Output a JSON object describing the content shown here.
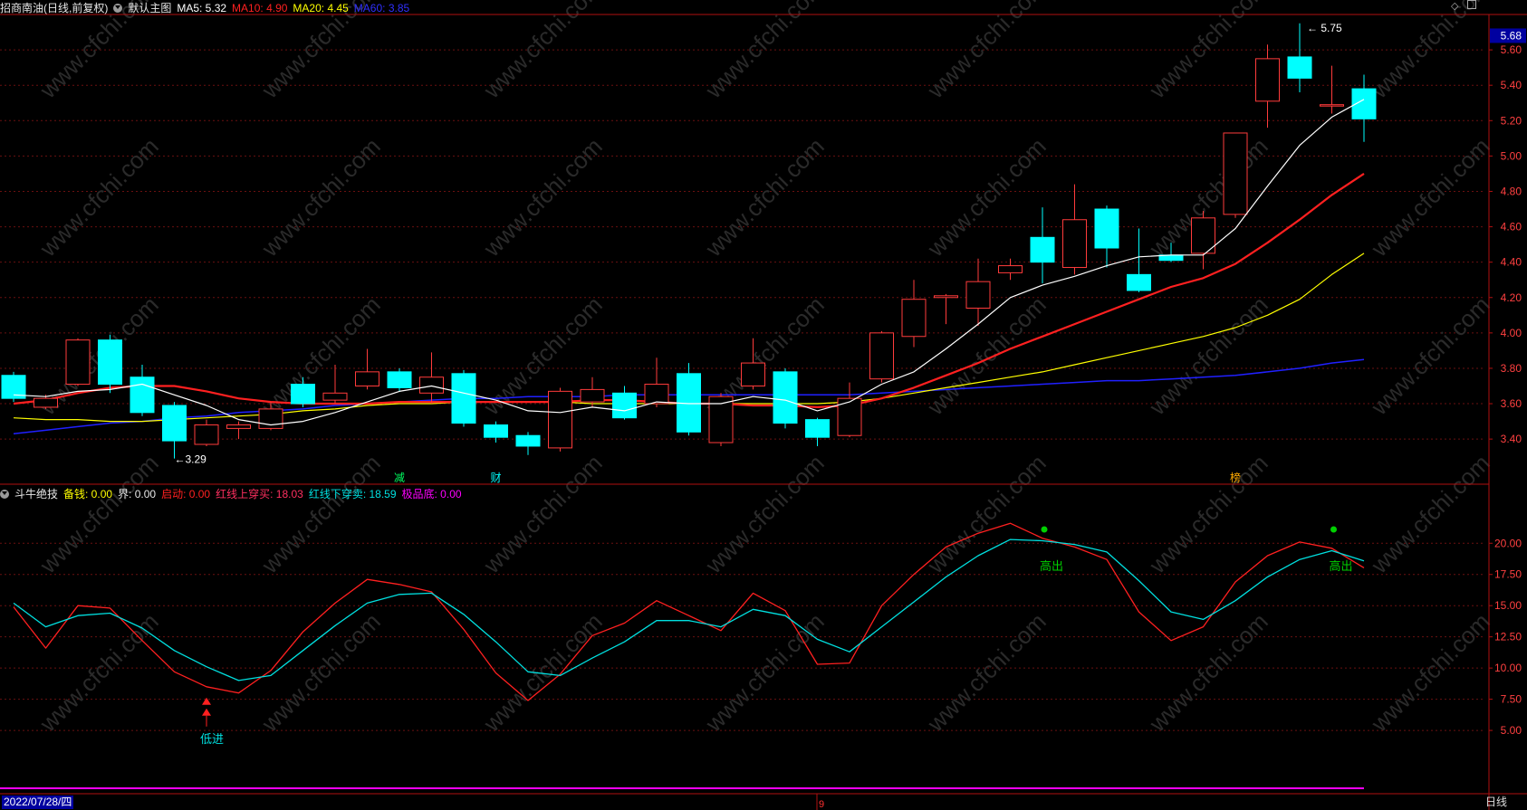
{
  "header": {
    "stock_title": "招商南油(日线,前复权)",
    "chart_name": "默认主图",
    "ma5_label": "MA5: 5.32",
    "ma10_label": "MA10: 4.90",
    "ma20_label": "MA20: 4.45",
    "ma60_label": "MA60: 3.85"
  },
  "indicator_header": {
    "name": "斗牛绝技",
    "beixian": "备钱: 0.00",
    "jie": "界: 0.00",
    "qidong": "启动: 0.00",
    "up_cross": "红线上穿买: 18.03",
    "down_cross": "红线下穿卖: 18.59",
    "bottom": "极品底: 0.00"
  },
  "footer": {
    "date": "2022/07/28/四",
    "period": "日线",
    "mid_marker": "9"
  },
  "colors": {
    "up": "#ff3b3b",
    "down": "#00ffff",
    "ma5": "#ffffff",
    "ma10": "#ff2020",
    "ma20": "#ffff00",
    "ma60": "#2020ff",
    "ind_red": "#ff2020",
    "ind_cyan": "#00e0e0",
    "magenta": "#ff00ff",
    "frame": "#b01010",
    "grid": "#6a1010"
  },
  "chart_data": [
    {
      "type": "candlestick",
      "y_ticks": [
        3.4,
        3.6,
        3.8,
        4.0,
        4.2,
        4.4,
        4.6,
        4.8,
        5.0,
        5.2,
        5.4,
        5.6
      ],
      "y_tick_labels": [
        "3.40",
        "3.60",
        "3.80",
        "4.00",
        "4.20",
        "4.40",
        "4.60",
        "4.80",
        "5.00",
        "5.20",
        "5.40",
        "5.60"
      ],
      "ylim": [
        3.15,
        5.8
      ],
      "current_price": "5.68",
      "max_label": "5.75",
      "min_label": "3.29",
      "candles": [
        [
          3.76,
          3.63,
          3.78,
          3.61
        ],
        [
          3.58,
          3.63,
          3.65,
          3.57
        ],
        [
          3.71,
          3.96,
          3.97,
          3.7
        ],
        [
          3.96,
          3.71,
          3.99,
          3.66
        ],
        [
          3.75,
          3.55,
          3.82,
          3.53
        ],
        [
          3.59,
          3.39,
          3.61,
          3.29
        ],
        [
          3.37,
          3.48,
          3.51,
          3.36
        ],
        [
          3.46,
          3.48,
          3.5,
          3.4
        ],
        [
          3.46,
          3.57,
          3.61,
          3.45
        ],
        [
          3.71,
          3.6,
          3.75,
          3.58
        ],
        [
          3.62,
          3.66,
          3.82,
          3.6
        ],
        [
          3.7,
          3.78,
          3.91,
          3.68
        ],
        [
          3.78,
          3.69,
          3.8,
          3.67
        ],
        [
          3.66,
          3.75,
          3.89,
          3.6
        ],
        [
          3.77,
          3.49,
          3.79,
          3.47
        ],
        [
          3.48,
          3.41,
          3.5,
          3.38
        ],
        [
          3.42,
          3.36,
          3.44,
          3.31
        ],
        [
          3.35,
          3.67,
          3.69,
          3.33
        ],
        [
          3.61,
          3.68,
          3.75,
          3.58
        ],
        [
          3.66,
          3.52,
          3.7,
          3.51
        ],
        [
          3.6,
          3.71,
          3.86,
          3.58
        ],
        [
          3.77,
          3.44,
          3.83,
          3.42
        ],
        [
          3.38,
          3.64,
          3.66,
          3.36
        ],
        [
          3.7,
          3.83,
          3.97,
          3.68
        ],
        [
          3.78,
          3.49,
          3.8,
          3.46
        ],
        [
          3.51,
          3.41,
          3.52,
          3.36
        ],
        [
          3.42,
          3.63,
          3.72,
          3.41
        ],
        [
          3.74,
          4.0,
          4.01,
          3.72
        ],
        [
          3.98,
          4.19,
          4.3,
          3.92
        ],
        [
          4.2,
          4.21,
          4.22,
          4.05
        ],
        [
          4.14,
          4.29,
          4.42,
          4.04
        ],
        [
          4.34,
          4.38,
          4.42,
          4.3
        ],
        [
          4.54,
          4.4,
          4.71,
          4.28
        ],
        [
          4.37,
          4.64,
          4.84,
          4.33
        ],
        [
          4.7,
          4.48,
          4.72,
          4.37
        ],
        [
          4.33,
          4.24,
          4.59,
          4.23
        ],
        [
          4.44,
          4.41,
          4.51,
          4.4
        ],
        [
          4.45,
          4.65,
          4.69,
          4.36
        ],
        [
          4.67,
          5.13,
          5.13,
          4.65
        ],
        [
          5.31,
          5.55,
          5.63,
          5.16
        ],
        [
          5.56,
          5.44,
          5.75,
          5.36
        ],
        [
          5.29,
          5.29,
          5.51,
          5.24
        ],
        [
          5.38,
          5.21,
          5.46,
          5.08
        ]
      ],
      "ma5": [
        3.65,
        3.64,
        3.67,
        3.68,
        3.71,
        3.65,
        3.59,
        3.51,
        3.48,
        3.5,
        3.55,
        3.61,
        3.67,
        3.7,
        3.66,
        3.62,
        3.56,
        3.55,
        3.58,
        3.56,
        3.61,
        3.6,
        3.6,
        3.64,
        3.62,
        3.56,
        3.61,
        3.71,
        3.78,
        3.91,
        4.05,
        4.2,
        4.27,
        4.32,
        4.38,
        4.43,
        4.44,
        4.44,
        4.59,
        4.83,
        5.06,
        5.22,
        5.32
      ],
      "ma10": [
        3.6,
        3.62,
        3.66,
        3.69,
        3.7,
        3.7,
        3.67,
        3.63,
        3.61,
        3.6,
        3.6,
        3.6,
        3.61,
        3.61,
        3.61,
        3.61,
        3.61,
        3.61,
        3.62,
        3.62,
        3.61,
        3.6,
        3.6,
        3.59,
        3.59,
        3.58,
        3.59,
        3.63,
        3.69,
        3.76,
        3.83,
        3.91,
        3.98,
        4.05,
        4.12,
        4.19,
        4.26,
        4.31,
        4.39,
        4.51,
        4.64,
        4.78,
        4.9
      ],
      "ma20": [
        3.52,
        3.51,
        3.51,
        3.5,
        3.5,
        3.51,
        3.52,
        3.53,
        3.54,
        3.56,
        3.57,
        3.59,
        3.6,
        3.6,
        3.61,
        3.61,
        3.61,
        3.61,
        3.6,
        3.6,
        3.6,
        3.6,
        3.6,
        3.6,
        3.6,
        3.6,
        3.61,
        3.63,
        3.66,
        3.69,
        3.72,
        3.75,
        3.78,
        3.82,
        3.86,
        3.9,
        3.94,
        3.98,
        4.03,
        4.1,
        4.19,
        4.33,
        4.45
      ],
      "ma60": [
        3.43,
        3.45,
        3.47,
        3.49,
        3.5,
        3.52,
        3.53,
        3.55,
        3.56,
        3.57,
        3.59,
        3.6,
        3.61,
        3.62,
        3.63,
        3.63,
        3.64,
        3.64,
        3.64,
        3.65,
        3.65,
        3.65,
        3.65,
        3.65,
        3.65,
        3.65,
        3.65,
        3.66,
        3.67,
        3.68,
        3.69,
        3.7,
        3.71,
        3.72,
        3.73,
        3.73,
        3.74,
        3.75,
        3.76,
        3.78,
        3.8,
        3.83,
        3.85
      ],
      "annotations": [
        {
          "index": 12,
          "text": "减"
        },
        {
          "index": 15,
          "text": "财"
        },
        {
          "index": 38,
          "text": "榜"
        }
      ]
    },
    {
      "type": "line",
      "y_ticks": [
        5.0,
        7.5,
        10.0,
        12.5,
        15.0,
        17.5,
        20.0
      ],
      "y_tick_labels": [
        "5.00",
        "7.50",
        "10.00",
        "12.50",
        "15.00",
        "17.50",
        "20.00"
      ],
      "ylim": [
        0,
        23.5
      ],
      "series": [
        {
          "values": [
            14.9,
            11.6,
            15.0,
            14.8,
            12.2,
            9.7,
            8.5,
            8.0,
            9.8,
            12.9,
            15.2,
            17.1,
            16.7,
            16.1,
            13.1,
            9.6,
            7.4,
            9.5,
            12.6,
            13.6,
            15.4,
            14.2,
            13.0,
            16.0,
            14.6,
            10.3,
            10.4,
            15.0,
            17.5,
            19.7,
            20.8,
            21.6,
            20.4,
            19.7,
            18.7,
            14.5,
            12.2,
            13.3,
            16.9,
            19.0,
            20.1,
            19.6,
            18.03
          ]
        },
        {
          "values": [
            15.2,
            13.3,
            14.2,
            14.4,
            13.2,
            11.4,
            10.1,
            9.0,
            9.4,
            11.4,
            13.4,
            15.2,
            15.9,
            16.0,
            14.3,
            12.1,
            9.7,
            9.4,
            10.8,
            12.1,
            13.8,
            13.8,
            13.3,
            14.7,
            14.2,
            12.3,
            11.3,
            13.3,
            15.3,
            17.3,
            19.0,
            20.3,
            20.2,
            19.9,
            19.3,
            17.0,
            14.5,
            13.9,
            15.4,
            17.3,
            18.7,
            19.4,
            18.59
          ]
        }
      ],
      "signals": [
        {
          "index": 6,
          "text": "低进"
        },
        {
          "index": 32,
          "text": "高出"
        },
        {
          "index": 41,
          "text": "高出"
        }
      ]
    }
  ]
}
